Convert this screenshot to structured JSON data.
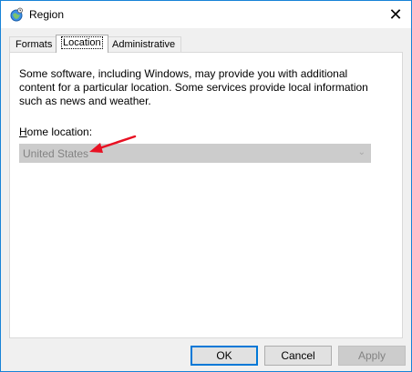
{
  "window": {
    "title": "Region",
    "close_glyph": "✕"
  },
  "tabs": [
    {
      "label": "Formats",
      "active": false
    },
    {
      "label": "Location",
      "active": true
    },
    {
      "label": "Administrative",
      "active": false
    }
  ],
  "location": {
    "description": "Some software, including Windows, may provide you with additional content for a particular location. Some services provide local information such as news and weather.",
    "home_label_access_key": "H",
    "home_label_rest": "ome location:",
    "home_value": "United States",
    "home_disabled": true
  },
  "buttons": {
    "ok": "OK",
    "cancel": "Cancel",
    "apply": "Apply"
  },
  "annotation": {
    "arrow_color": "#e81123"
  },
  "icons": {
    "title": "region-globe-icon",
    "close": "close-icon",
    "dropdown": "chevron-down-icon"
  }
}
